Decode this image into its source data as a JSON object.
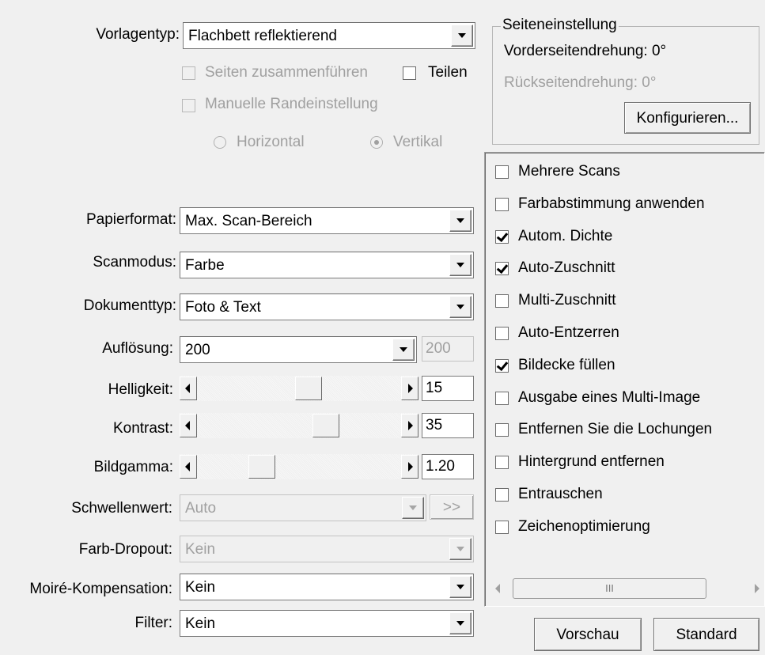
{
  "vorlagentyp": {
    "label": "Vorlagentyp:",
    "value": "Flachbett reflektierend"
  },
  "seiten_zusammen": {
    "label": "Seiten zusammenführen",
    "checked": false,
    "enabled": false
  },
  "teilen": {
    "label": "Teilen",
    "checked": false,
    "enabled": true
  },
  "manuelle_rand": {
    "label": "Manuelle Randeinstellung",
    "checked": false,
    "enabled": false
  },
  "orientation": {
    "horizontal": "Horizontal",
    "vertikal": "Vertikal",
    "selected": "Vertikal"
  },
  "seiteneinstellung": {
    "title": "Seiteneinstellung",
    "vorder": "Vorderseitendrehung: 0°",
    "rueck": "Rückseitendrehung: 0°",
    "konfig_button": "Konfigurieren..."
  },
  "papierformat": {
    "label": "Papierformat:",
    "value": "Max. Scan-Bereich"
  },
  "scanmodus": {
    "label": "Scanmodus:",
    "value": "Farbe"
  },
  "dokumenttyp": {
    "label": "Dokumenttyp:",
    "value": "Foto & Text"
  },
  "aufloesung": {
    "label": "Auflösung:",
    "value": "200",
    "box": "200"
  },
  "helligkeit": {
    "label": "Helligkeit:",
    "value": "15"
  },
  "kontrast": {
    "label": "Kontrast:",
    "value": "35"
  },
  "bildgamma": {
    "label": "Bildgamma:",
    "value": "1.20"
  },
  "schwellenwert": {
    "label": "Schwellenwert:",
    "value": "Auto",
    "more_button": ">>"
  },
  "farb_dropout": {
    "label": "Farb-Dropout:",
    "value": "Kein"
  },
  "moire": {
    "label": "Moiré-Kompensation:",
    "value": "Kein"
  },
  "filter": {
    "label": "Filter:",
    "value": "Kein"
  },
  "options": [
    {
      "label": "Mehrere Scans",
      "checked": false
    },
    {
      "label": "Farbabstimmung anwenden",
      "checked": false
    },
    {
      "label": "Autom. Dichte",
      "checked": true
    },
    {
      "label": "Auto-Zuschnitt",
      "checked": true
    },
    {
      "label": "Multi-Zuschnitt",
      "checked": false
    },
    {
      "label": "Auto-Entzerren",
      "checked": false
    },
    {
      "label": "Bildecke füllen",
      "checked": true
    },
    {
      "label": "Ausgabe eines Multi-Image",
      "checked": false
    },
    {
      "label": "Entfernen Sie die Lochungen",
      "checked": false
    },
    {
      "label": "Hintergrund entfernen",
      "checked": false
    },
    {
      "label": "Entrauschen",
      "checked": false
    },
    {
      "label": "Zeichenoptimierung",
      "checked": false
    }
  ],
  "hscroll_grip": "III",
  "buttons": {
    "vorschau": "Vorschau",
    "standard": "Standard"
  }
}
